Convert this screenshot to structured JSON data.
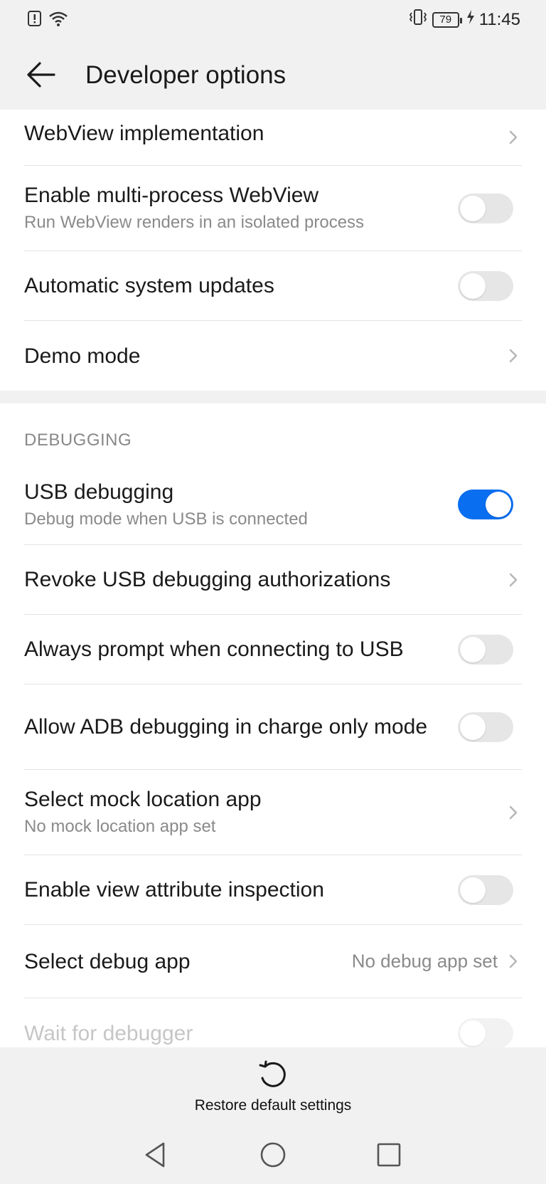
{
  "status_bar": {
    "time": "11:45",
    "battery": "79"
  },
  "header": {
    "title": "Developer options"
  },
  "group1": [
    {
      "title": "WebView implementation",
      "subtitle": "",
      "control": "chevron"
    },
    {
      "title": "Enable multi-process WebView",
      "subtitle": "Run WebView renders in an isolated process",
      "control": "toggle",
      "on": false
    },
    {
      "title": "Automatic system updates",
      "subtitle": "",
      "control": "toggle",
      "on": false
    },
    {
      "title": "Demo mode",
      "subtitle": "",
      "control": "chevron"
    }
  ],
  "debugging": {
    "section_label": "DEBUGGING",
    "items": [
      {
        "title": "USB debugging",
        "subtitle": "Debug mode when USB is connected",
        "control": "toggle",
        "on": true
      },
      {
        "title": "Revoke USB debugging authorizations",
        "subtitle": "",
        "control": "chevron"
      },
      {
        "title": "Always prompt when connecting to USB",
        "subtitle": "",
        "control": "toggle",
        "on": false
      },
      {
        "title": "Allow ADB debugging in charge only mode",
        "subtitle": "",
        "control": "toggle",
        "on": false
      },
      {
        "title": "Select mock location app",
        "subtitle": "No mock location app set",
        "control": "chevron"
      },
      {
        "title": "Enable view attribute inspection",
        "subtitle": "",
        "control": "toggle",
        "on": false
      },
      {
        "title": "Select debug app",
        "subtitle": "",
        "value": "No debug app set",
        "control": "chevron"
      },
      {
        "title": "Wait for debugger",
        "subtitle": "",
        "control": "toggle",
        "on": false,
        "disabled": true
      }
    ]
  },
  "footer": {
    "restore_label": "Restore default settings"
  },
  "colors": {
    "accent": "#0a6ef0",
    "toggle_off": "#e6e6e6",
    "background": "#f1f1f1"
  }
}
